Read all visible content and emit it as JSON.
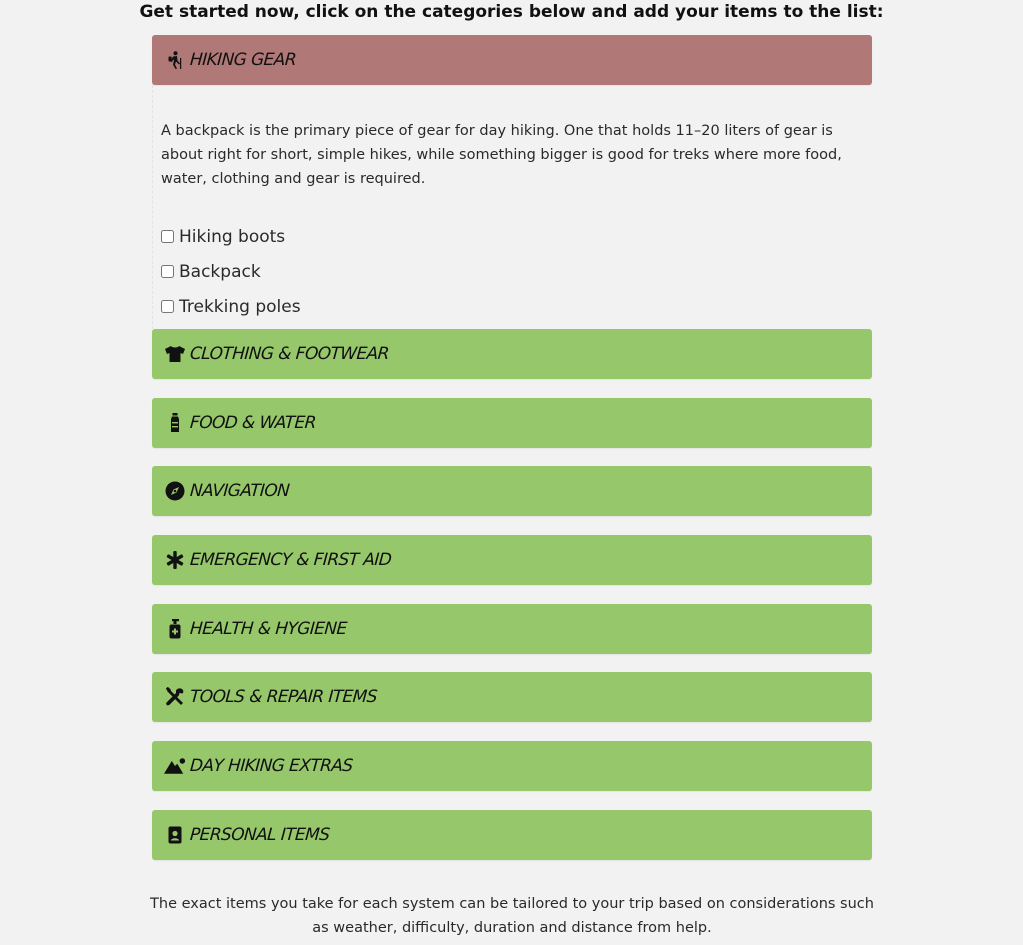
{
  "intro": "Get started now, click on the categories below and add your items to the list:",
  "colors": {
    "open_header": "#b07876",
    "closed_header": "#96c76a",
    "background": "#f2f2f2"
  },
  "open_category": {
    "label": "Hiking gear",
    "icon": "hiking-person-icon",
    "description": "A backpack is the primary piece of gear for day hiking. One that holds 11–20 liters of gear is about right for short, simple hikes, while something bigger is good for treks where more food, water, clothing and gear is required.",
    "items": [
      {
        "label": "Hiking boots",
        "checked": false
      },
      {
        "label": "Backpack",
        "checked": false
      },
      {
        "label": "Trekking poles",
        "checked": false
      }
    ]
  },
  "categories": [
    {
      "label": "Clothing & Footwear",
      "icon": "tshirt-icon"
    },
    {
      "label": "Food & Water",
      "icon": "bottle-icon"
    },
    {
      "label": "Navigation",
      "icon": "compass-icon"
    },
    {
      "label": "Emergency & First aid",
      "icon": "asterisk-icon"
    },
    {
      "label": "Health & Hygiene",
      "icon": "pump-bottle-icon"
    },
    {
      "label": "Tools & Repair items",
      "icon": "tools-icon"
    },
    {
      "label": "Day hiking extras",
      "icon": "mountain-sun-icon"
    },
    {
      "label": "Personal items",
      "icon": "id-badge-icon"
    }
  ],
  "footer": "The exact items you take for each system can be tailored to your trip based on considerations such as weather, difficulty, duration and distance from help."
}
